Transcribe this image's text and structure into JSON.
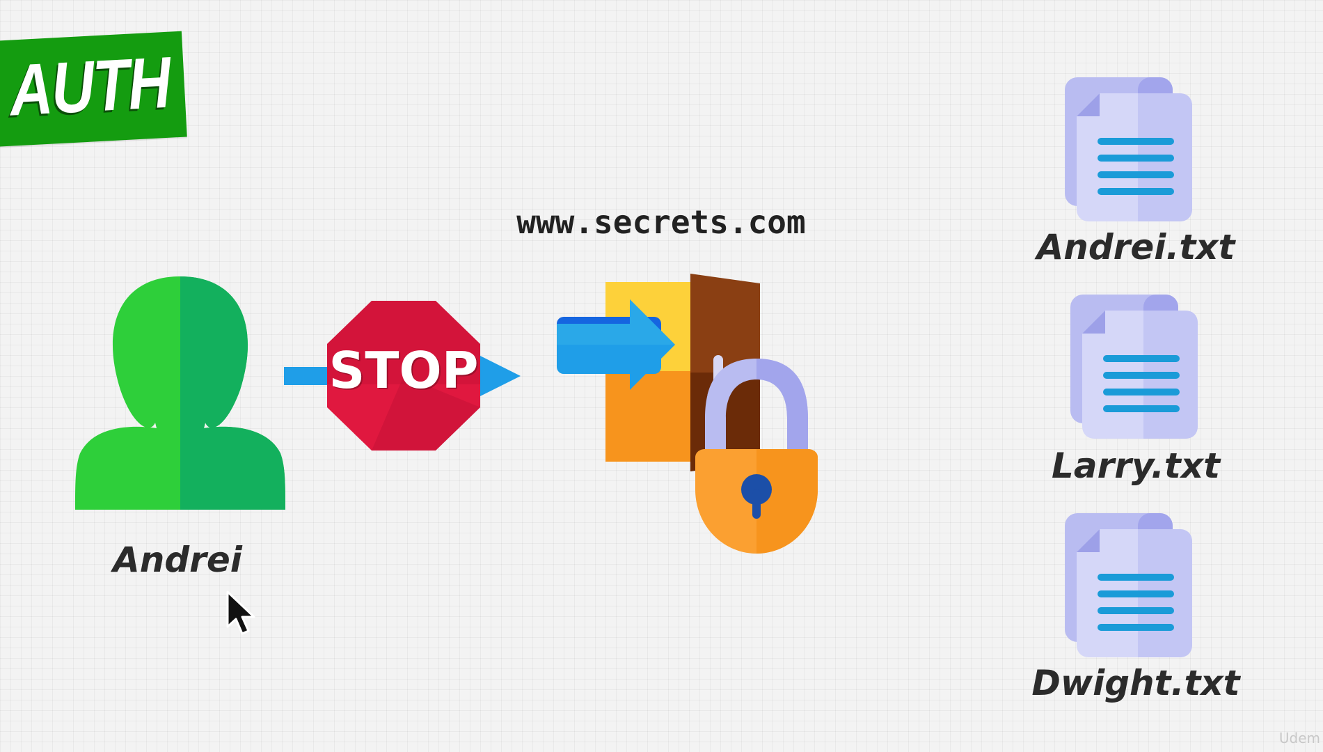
{
  "banner": {
    "title": "AUTH"
  },
  "user": {
    "name": "Andrei"
  },
  "block_sign": {
    "text": "STOP"
  },
  "site": {
    "url": "www.secrets.com"
  },
  "files": [
    {
      "name": "Andrei.txt"
    },
    {
      "name": "Larry.txt"
    },
    {
      "name": "Dwight.txt"
    }
  ],
  "watermark": "Udem",
  "colors": {
    "banner": "#149c10",
    "user_light": "#2ecf3a",
    "user_dark": "#13b05d",
    "stop_red": "#e0183f",
    "arrow_blue": "#1f9ee8",
    "door_brown": "#8a3f13",
    "lock_orange": "#f7941d",
    "file_lavender": "#b9bcf1",
    "file_lines": "#1a9bd8"
  }
}
